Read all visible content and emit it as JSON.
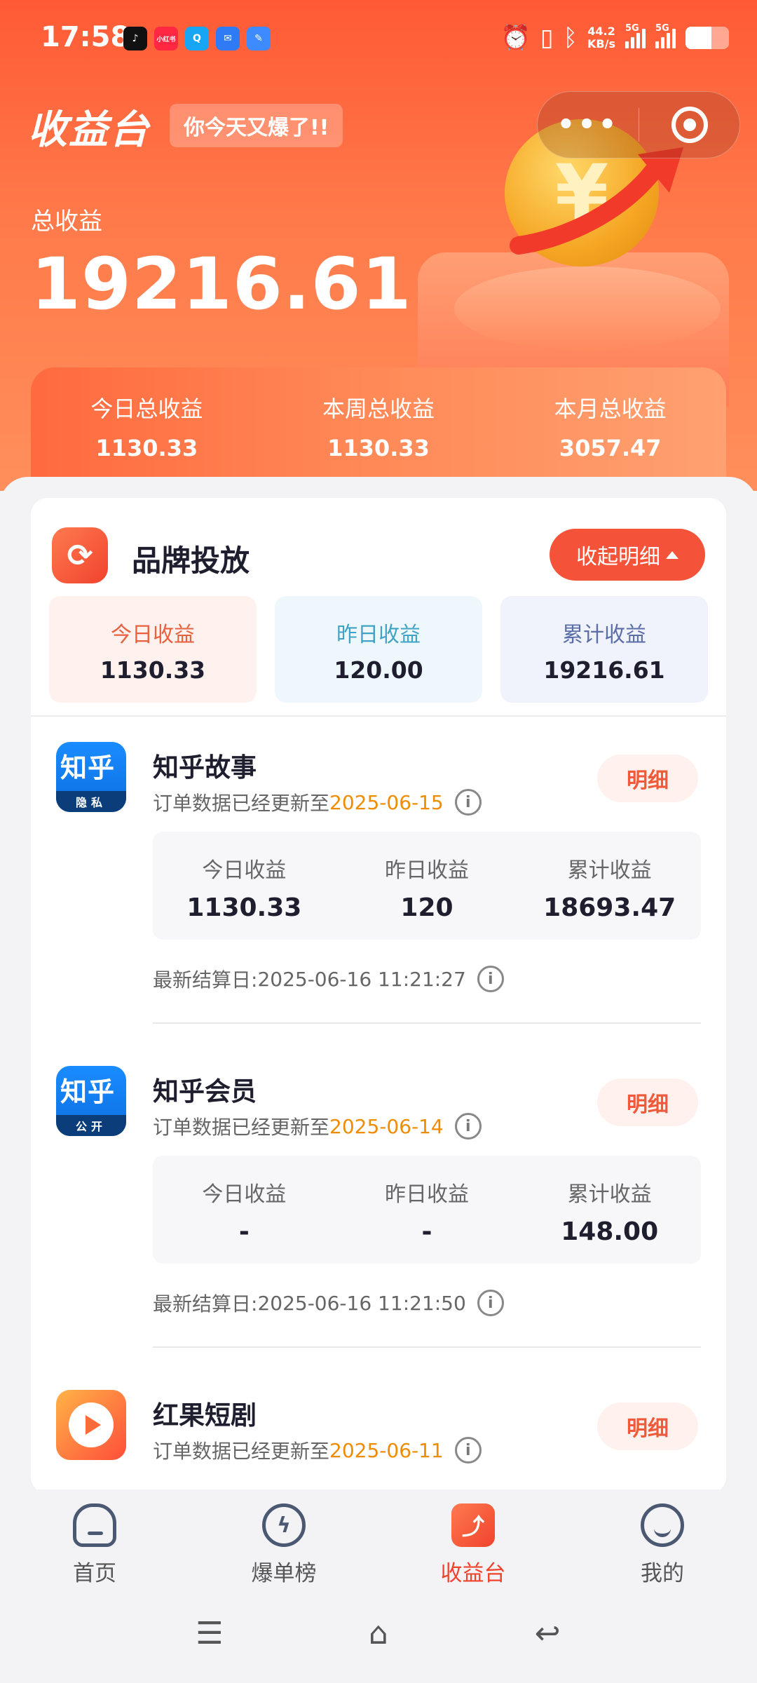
{
  "status_bar": {
    "time": "17:58",
    "net_speed": "44.2",
    "net_unit": "KB/s",
    "sim1": "5G",
    "sim2": "5G",
    "battery_level": 0.6,
    "apps": [
      {
        "icon": "tiktok-icon",
        "label": "♪",
        "color": "#111111"
      },
      {
        "icon": "xiaohongshu-icon",
        "label": "小红书",
        "color": "#ff2742"
      },
      {
        "icon": "chat-icon",
        "label": "Q",
        "color": "#16a6f5"
      },
      {
        "icon": "message-icon",
        "label": "✉",
        "color": "#2f7bf5"
      },
      {
        "icon": "feather-icon",
        "label": "✎",
        "color": "#3d8bff"
      }
    ]
  },
  "header": {
    "title": "收益台",
    "tag": "你今天又爆了!!",
    "menu_icon": "more-dots-icon",
    "close_icon": "target-icon"
  },
  "summary": {
    "total_label": "总收益",
    "total_value": "19216.61",
    "periods": [
      {
        "label": "今日总收益",
        "value": "1130.33"
      },
      {
        "label": "本周总收益",
        "value": "1130.33"
      },
      {
        "label": "本月总收益",
        "value": "3057.47"
      }
    ]
  },
  "brand": {
    "name": "品牌投放",
    "collapse_label": "收起明细",
    "stats": [
      {
        "label": "今日收益",
        "value": "1130.33"
      },
      {
        "label": "昨日收益",
        "value": "120.00"
      },
      {
        "label": "累计收益",
        "value": "19216.61"
      }
    ]
  },
  "apps": [
    {
      "name": "知乎故事",
      "icon_text": "知乎",
      "icon_strip": "隐私",
      "update_prefix": "订单数据已经更新至",
      "update_date": "2025-06-15",
      "detail_label": "明细",
      "stats": [
        {
          "label": "今日收益",
          "value": "1130.33"
        },
        {
          "label": "昨日收益",
          "value": "120"
        },
        {
          "label": "累计收益",
          "value": "18693.47"
        }
      ],
      "settle_label": "最新结算日:",
      "settle_time": "2025-06-16 11:21:27"
    },
    {
      "name": "知乎会员",
      "icon_text": "知乎",
      "icon_strip": "公开",
      "update_prefix": "订单数据已经更新至",
      "update_date": "2025-06-14",
      "detail_label": "明细",
      "stats": [
        {
          "label": "今日收益",
          "value": "-"
        },
        {
          "label": "昨日收益",
          "value": "-"
        },
        {
          "label": "累计收益",
          "value": "148.00"
        }
      ],
      "settle_label": "最新结算日:",
      "settle_time": "2025-06-16 11:21:50"
    },
    {
      "name": "红果短剧",
      "update_prefix": "订单数据已经更新至",
      "update_date": "2025-06-11",
      "detail_label": "明细"
    }
  ],
  "tabbar": [
    {
      "label": "首页",
      "icon": "home-icon"
    },
    {
      "label": "爆单榜",
      "icon": "lightning-icon"
    },
    {
      "label": "收益台",
      "icon": "earnings-icon"
    },
    {
      "label": "我的",
      "icon": "profile-icon"
    }
  ],
  "system_nav": [
    {
      "icon": "menu-icon",
      "glyph": "☰"
    },
    {
      "icon": "home-outline-icon",
      "glyph": "⌂"
    },
    {
      "icon": "back-icon",
      "glyph": "↩"
    }
  ],
  "colors": {
    "accent": "#f0432c",
    "hero_gradient_start": "#ff5a36",
    "date_highlight": "#f08c00"
  }
}
